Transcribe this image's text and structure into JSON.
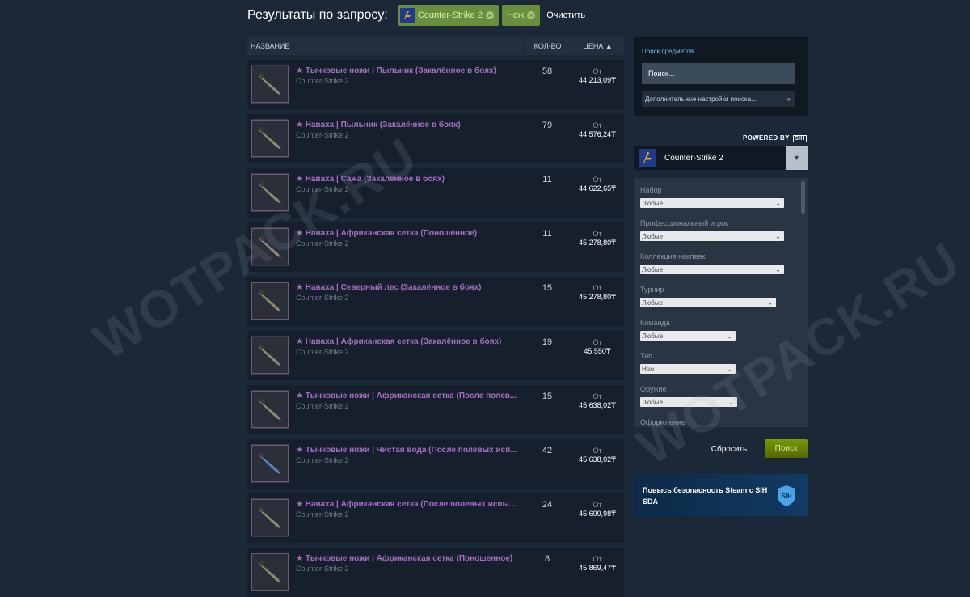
{
  "header": {
    "title": "Результаты по запросу:",
    "chips": [
      {
        "label": "Counter-Strike 2",
        "icon": "cs2-icon"
      },
      {
        "label": "Нож"
      }
    ],
    "clear_label": "Очистить"
  },
  "list": {
    "columns": {
      "name": "НАЗВАНИЕ",
      "qty": "КОЛ-ВО",
      "price": "ЦЕНА ▲"
    },
    "from_label": "От",
    "rows": [
      {
        "name": "★ Тычковые ножи | Пыльник (Закалённое в боях)",
        "game": "Counter-Strike 2",
        "qty": "58",
        "price": "44 213,09₸"
      },
      {
        "name": "★ Наваха | Пыльник (Закалённое в боях)",
        "game": "Counter-Strike 2",
        "qty": "79",
        "price": "44 576,24₸"
      },
      {
        "name": "★ Наваха | Сажа (Закалённое в боях)",
        "game": "Counter-Strike 2",
        "qty": "11",
        "price": "44 622,65₸"
      },
      {
        "name": "★ Наваха | Африканская сетка (Поношенное)",
        "game": "Counter-Strike 2",
        "qty": "11",
        "price": "45 278,80₸"
      },
      {
        "name": "★ Наваха | Северный лес (Закалённое в боях)",
        "game": "Counter-Strike 2",
        "qty": "15",
        "price": "45 278,80₸"
      },
      {
        "name": "★ Наваха | Африканская сетка (Закалённое в боях)",
        "game": "Counter-Strike 2",
        "qty": "19",
        "price": "45 550₸"
      },
      {
        "name": "★ Тычковые ножи | Африканская сетка (После полев...",
        "game": "Counter-Strike 2",
        "qty": "15",
        "price": "45 638,02₸"
      },
      {
        "name": "★ Тычковые ножи | Чистая вода (После полевых исп...",
        "game": "Counter-Strike 2",
        "qty": "42",
        "price": "45 638,02₸"
      },
      {
        "name": "★ Наваха | Африканская сетка (После полевых испы...",
        "game": "Counter-Strike 2",
        "qty": "24",
        "price": "45 699,98₸"
      },
      {
        "name": "★ Тычковые ножи | Африканская сетка (Поношенное)",
        "game": "Counter-Strike 2",
        "qty": "8",
        "price": "45 869,47₸"
      }
    ]
  },
  "search_panel": {
    "title": "Поиск предметов",
    "placeholder": "Поиск...",
    "advanced_label": "Дополнительные настройки поиска...",
    "powered_by": "POWERED BY",
    "powered_badge": "SIH"
  },
  "game_select": {
    "label": "Counter-Strike 2"
  },
  "filters": [
    {
      "label": "Набор",
      "value": "Любые"
    },
    {
      "label": "Профессиональный игрок",
      "value": "Любые"
    },
    {
      "label": "Коллекция наклеек",
      "value": "Любые"
    },
    {
      "label": "Турнир",
      "value": "Любые"
    },
    {
      "label": "Команда",
      "value": "Любые"
    },
    {
      "label": "Тип",
      "value": "Нож"
    },
    {
      "label": "Оружие",
      "value": "Любые"
    },
    {
      "label": "Оформление",
      "value": ""
    }
  ],
  "buttons": {
    "reset": "Сбросить",
    "search": "Поиск"
  },
  "banner": {
    "text": "Повысь безопасность Steam с SIH SDA",
    "badge": "SIH"
  },
  "watermark": "WOTPACK.RU",
  "colors": {
    "background": "#1b2838",
    "accent_green": "#688f3e",
    "item_name": "#a66ec3",
    "link": "#67c1f5"
  }
}
